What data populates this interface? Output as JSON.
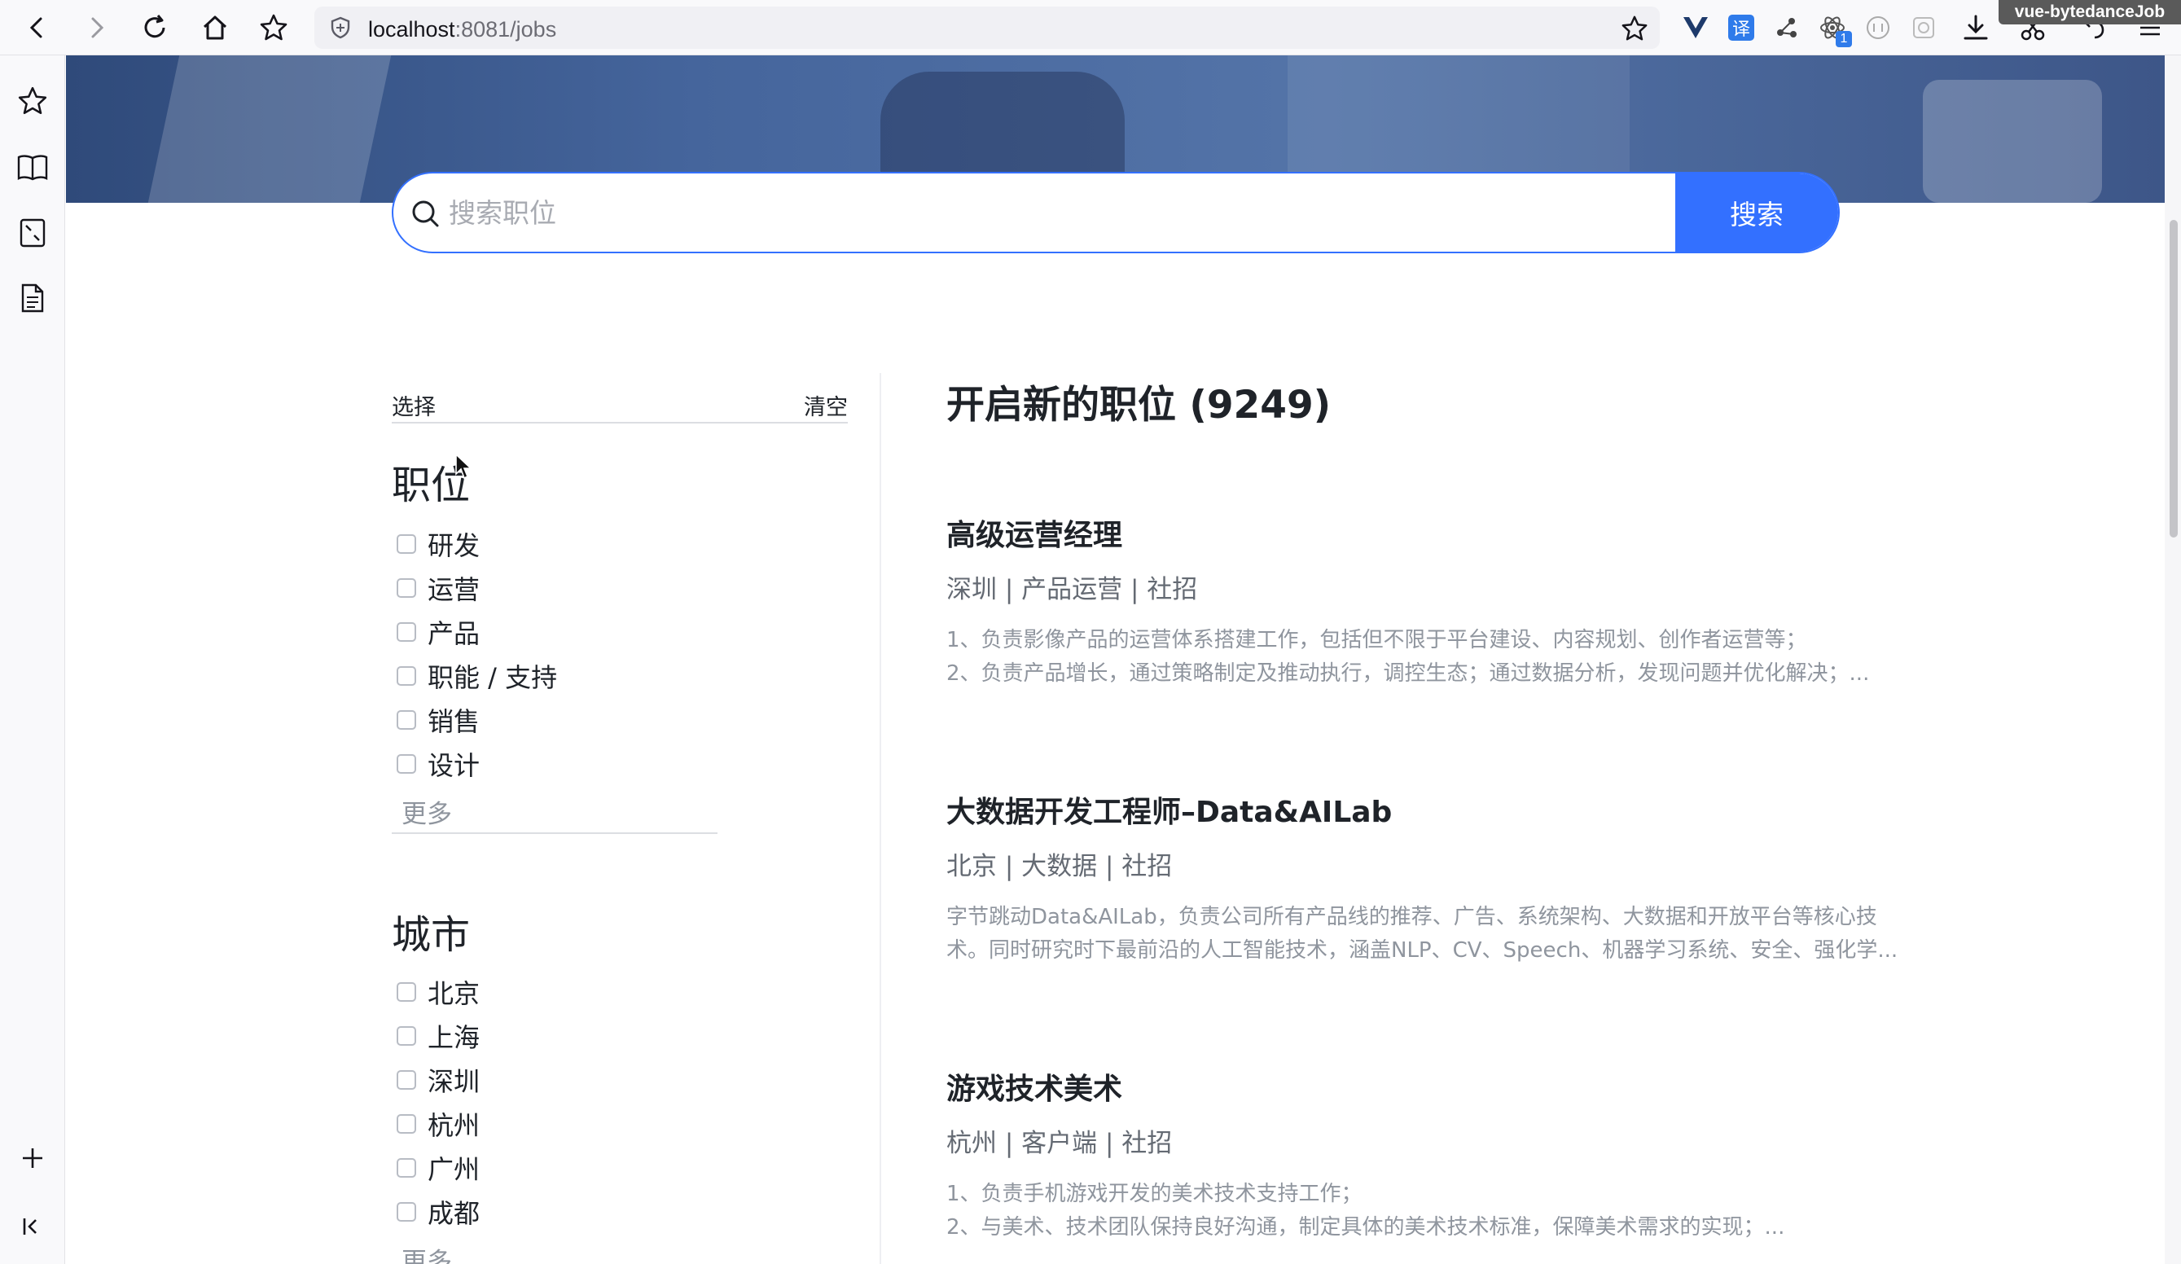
{
  "browser": {
    "url_host": "localhost",
    "url_port": ":8081",
    "url_path": "/jobs",
    "extension_badge": "vue-bytedanceJob",
    "extension_count": "1",
    "translate_label": "译"
  },
  "search": {
    "placeholder": "搜索职位",
    "button_label": "搜索"
  },
  "filters": {
    "select_label": "选择",
    "clear_label": "清空",
    "position_title": "职位",
    "positions": [
      "研发",
      "运营",
      "产品",
      "职能 / 支持",
      "销售",
      "设计"
    ],
    "more_label": "更多",
    "city_title": "城市",
    "cities": [
      "北京",
      "上海",
      "深圳",
      "杭州",
      "广州",
      "成都"
    ],
    "city_more_label": "更多"
  },
  "jobs": {
    "heading": "开启新的职位 (9249)",
    "items": [
      {
        "title": "高级运营经理",
        "meta": "深圳 | 产品运营 | 社招",
        "desc": [
          "1、负责影像产品的运营体系搭建工作，包括但不限于平台建设、内容规划、创作者运营等；",
          "2、负责产品增长，通过策略制定及推动执行，调控生态；通过数据分析，发现问题并优化解决；..."
        ]
      },
      {
        "title": "大数据开发工程师–Data&AILab",
        "meta": "北京 | 大数据 | 社招",
        "desc": [
          "字节跳动Data&AILab，负责公司所有产品线的推荐、广告、系统架构、大数据和开放平台等核心技",
          "术。同时研究时下最前沿的人工智能技术，涵盖NLP、CV、Speech、机器学习系统、安全、强化学..."
        ]
      },
      {
        "title": "游戏技术美术",
        "meta": "杭州 | 客户端 | 社招",
        "desc": [
          "1、负责手机游戏开发的美术技术支持工作；",
          "2、与美术、技术团队保持良好沟通，制定具体的美术技术标准，保障美术需求的实现；..."
        ]
      }
    ]
  },
  "colors": {
    "accent": "#3370ff",
    "text_primary": "#1f2329",
    "text_secondary": "#646a73",
    "text_muted": "#8f959e"
  }
}
